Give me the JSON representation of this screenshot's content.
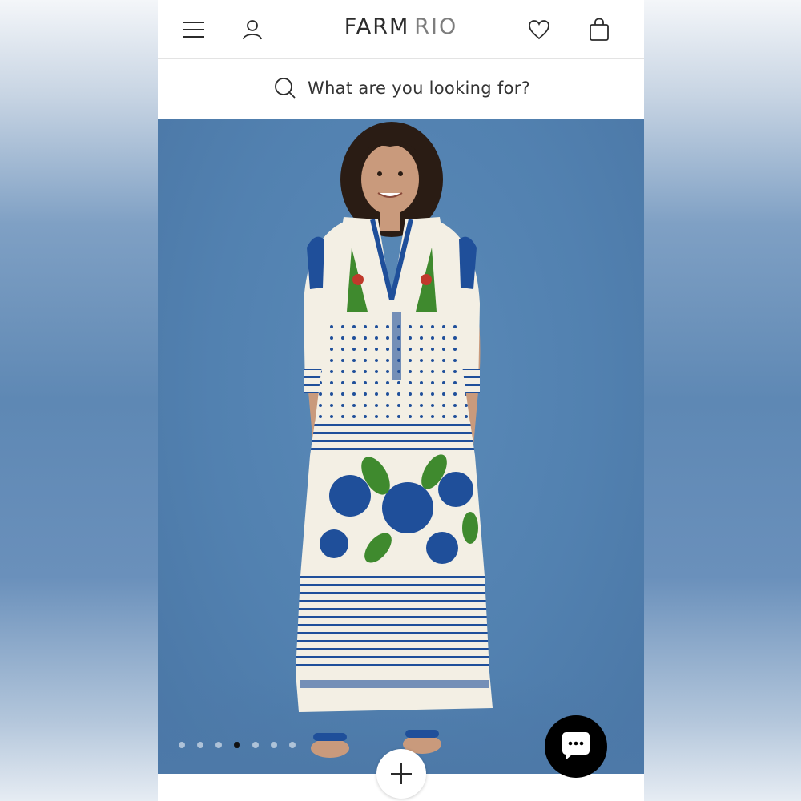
{
  "header": {
    "brand_primary": "FARM",
    "brand_secondary": "RIO",
    "menu_icon": "hamburger-menu-icon",
    "account_icon": "user-icon",
    "wishlist_icon": "heart-icon",
    "cart_icon": "shopping-bag-icon"
  },
  "search": {
    "placeholder": "What are you looking for?",
    "icon": "search-icon"
  },
  "gallery": {
    "image_description_alt": "Model wearing printed maxi dress",
    "total_images": 7,
    "active_index": 3,
    "add_icon": "plus-icon"
  },
  "chat": {
    "icon": "chat-bubble-icon"
  },
  "colors": {
    "background_blue": "#5281b0",
    "text_dark": "#2b2b2b",
    "dress_blue": "#1f4f9a",
    "dress_green": "#3f8a2e"
  }
}
